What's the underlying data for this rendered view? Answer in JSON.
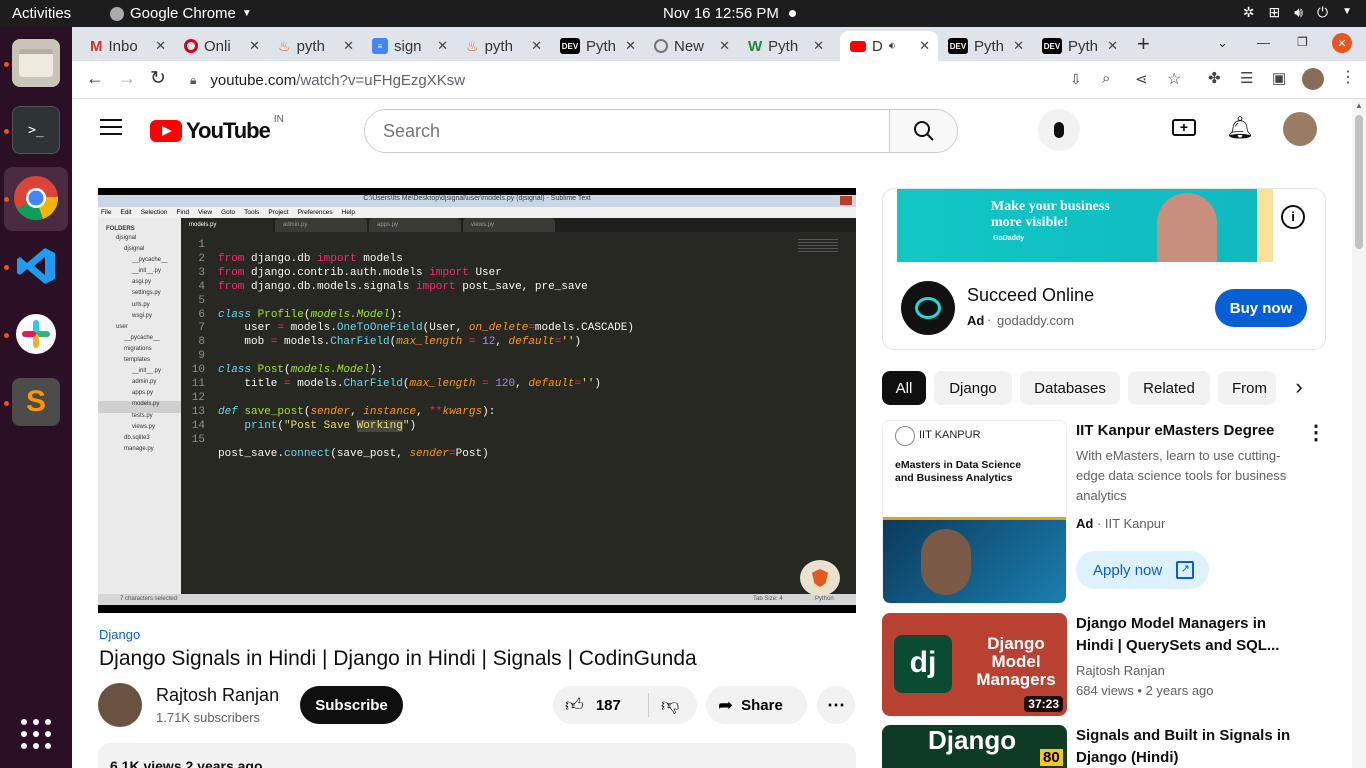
{
  "os": {
    "activities": "Activities",
    "app_name": "Google Chrome",
    "datetime": "Nov 16  12:56 PM"
  },
  "browser": {
    "tabs": [
      {
        "title": "Inbo",
        "icon": "gmail-icon"
      },
      {
        "title": "Onli",
        "icon": "opera-icon"
      },
      {
        "title": "pyth",
        "icon": "flame-icon"
      },
      {
        "title": "sign",
        "icon": "docs-icon"
      },
      {
        "title": "pyth",
        "icon": "flame-icon"
      },
      {
        "title": "Pyth",
        "icon": "dev-icon"
      },
      {
        "title": "New",
        "icon": "globe-icon"
      },
      {
        "title": "Pyth",
        "icon": "w-icon"
      },
      {
        "title": "D",
        "icon": "youtube-icon"
      },
      {
        "title": "Pyth",
        "icon": "dev-icon"
      },
      {
        "title": "Pyth",
        "icon": "dev-icon"
      }
    ],
    "url": "youtube.com/watch?v=uFHgEzgXKsw",
    "url_host": "youtube.com",
    "url_path": "/watch?v=uFHgEzgXKsw"
  },
  "youtube": {
    "logo_text": "YouTube",
    "region": "IN",
    "search_placeholder": "Search"
  },
  "editor": {
    "window_title": "C:\\Users\\Its Me\\Desktop\\djsignal\\user\\models.py (djsignal) - Sublime Text",
    "menu": [
      "File",
      "Edit",
      "Selection",
      "Find",
      "View",
      "Goto",
      "Tools",
      "Project",
      "Preferences",
      "Help"
    ],
    "tabs": [
      "models.py",
      "admin.py",
      "apps.py",
      "views.py"
    ],
    "folders_label": "FOLDERS",
    "tree": [
      "djsignal",
      "djsignal",
      "__pycache__",
      "__init__.py",
      "asgi.py",
      "settings.py",
      "urls.py",
      "wsgi.py",
      "user",
      "__pycache__",
      "migrations",
      "templates",
      "__init__.py",
      "admin.py",
      "apps.py",
      "models.py",
      "tests.py",
      "views.py",
      "db.sqlite3",
      "manage.py"
    ],
    "line_numbers": [
      "1",
      "2",
      "3",
      "4",
      "5",
      "6",
      "7",
      "8",
      "9",
      "10",
      "11",
      "12",
      "13",
      "14",
      "15"
    ],
    "status_left": "7 characters selected",
    "status_tab": "Tab Size: 4",
    "status_lang": "Python"
  },
  "video": {
    "hashtag": "Django",
    "title": "Django Signals in Hindi | Django in Hindi | Signals | CodinGunda",
    "channel": "Rajtosh Ranjan",
    "subscribers": "1.71K subscribers",
    "subscribe_label": "Subscribe",
    "likes": "187",
    "share_label": "Share",
    "views_partial": "6.1K views  2 years ago"
  },
  "ad": {
    "banner_line1": "Make your business",
    "banner_line2": "more visible!",
    "banner_brand": "GoDaddy",
    "title": "Succeed Online",
    "ad_label": "Ad",
    "domain": "godaddy.com",
    "cta": "Buy now"
  },
  "chips": [
    "All",
    "Django",
    "Databases",
    "Related",
    "From"
  ],
  "recommendations": [
    {
      "title": "IIT Kanpur eMasters Degree",
      "description": "With eMasters, learn to use cutting-edge data science tools for business analytics",
      "ad_label": "Ad",
      "advertiser": "IIT Kanpur",
      "cta": "Apply now",
      "thumb_brand": "IIT KANPUR",
      "thumb_text": "eMasters in Data Science and Business Analytics"
    },
    {
      "title": "Django Model Managers in Hindi | QuerySets and SQL...",
      "channel": "Rajtosh Ranjan",
      "meta": "684 views  •  2 years ago",
      "duration": "37:23",
      "thumb_text": "Django Model Managers",
      "thumb_logo": "dj"
    },
    {
      "title": "Signals and Built in Signals in Django (Hindi)",
      "thumb_text": "Django",
      "duration": "80"
    }
  ],
  "colors": {
    "youtube_red": "#ff0000",
    "ubuntu_orange": "#e95420",
    "link_blue": "#065fd4",
    "buy_blue": "#065fd4"
  }
}
